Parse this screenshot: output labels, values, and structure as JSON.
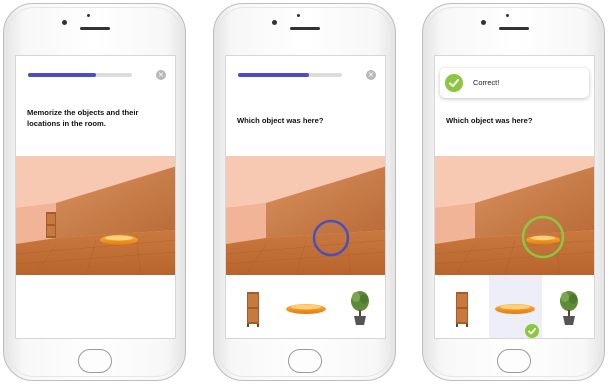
{
  "screens": [
    {
      "progress_fraction": 0.65,
      "close_icon": "×",
      "prompt": "Memorize the objects and their locations in the room.",
      "objects_in_room": [
        "cabinet",
        "boat"
      ],
      "choices": []
    },
    {
      "progress_fraction": 0.68,
      "close_icon": "×",
      "prompt": "Which object was here?",
      "highlight_color": "#4b4ec0",
      "objects_in_room": [],
      "choices": [
        "cabinet",
        "boat",
        "potted-plant"
      ]
    },
    {
      "toast_text": "Correct!",
      "prompt": "Which object was here?",
      "highlight_color": "#8dc63f",
      "objects_in_room": [
        "boat"
      ],
      "choices": [
        "cabinet",
        "boat",
        "potted-plant"
      ],
      "selected_choice": "boat"
    }
  ],
  "colors": {
    "accent": "#4b4ec0",
    "success": "#8dc63f",
    "selected_bg": "#eeeef8",
    "room_wall": "#f4b79c",
    "room_floor": "#c4733d"
  }
}
